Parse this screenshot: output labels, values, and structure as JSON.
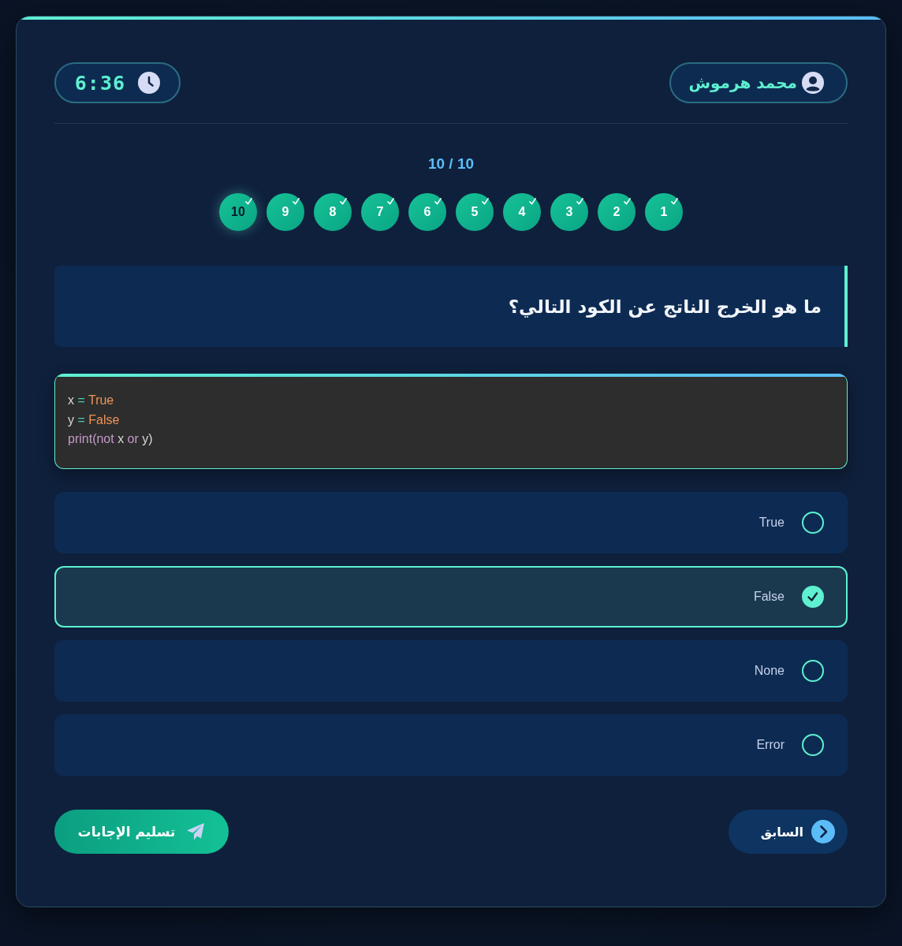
{
  "user": {
    "name": "محمد هرموش"
  },
  "timer": {
    "time": "6:36"
  },
  "progress": {
    "counter": "10 / 10"
  },
  "question_nav": [
    {
      "label": "10",
      "answered": true,
      "selected": true
    },
    {
      "label": "9",
      "answered": true,
      "selected": false
    },
    {
      "label": "8",
      "answered": true,
      "selected": false
    },
    {
      "label": "7",
      "answered": true,
      "selected": false
    },
    {
      "label": "6",
      "answered": true,
      "selected": false
    },
    {
      "label": "5",
      "answered": true,
      "selected": false
    },
    {
      "label": "4",
      "answered": true,
      "selected": false
    },
    {
      "label": "3",
      "answered": true,
      "selected": false
    },
    {
      "label": "2",
      "answered": true,
      "selected": false
    },
    {
      "label": "1",
      "answered": true,
      "selected": false
    }
  ],
  "question": {
    "text": "ما هو الخرج الناتج عن الكود التالي؟"
  },
  "code": {
    "lines": [
      [
        {
          "kind": "name",
          "text": "x "
        },
        {
          "kind": "operator",
          "text": "="
        },
        {
          "kind": "constant",
          "text": " True"
        }
      ],
      [
        {
          "kind": "name",
          "text": "y "
        },
        {
          "kind": "operator",
          "text": "="
        },
        {
          "kind": "constant",
          "text": " False"
        }
      ],
      [
        {
          "kind": "function",
          "text": "print("
        },
        {
          "kind": "keyword",
          "text": "not"
        },
        {
          "kind": "name",
          "text": " x "
        },
        {
          "kind": "keyword",
          "text": "or"
        },
        {
          "kind": "name",
          "text": " y)"
        }
      ]
    ]
  },
  "options": [
    {
      "label": "True",
      "selected": false
    },
    {
      "label": "False",
      "selected": true
    },
    {
      "label": "None",
      "selected": false
    },
    {
      "label": "Error",
      "selected": false
    }
  ],
  "buttons": {
    "previous": "السابق",
    "submit": "تسليم الإجابات"
  }
}
